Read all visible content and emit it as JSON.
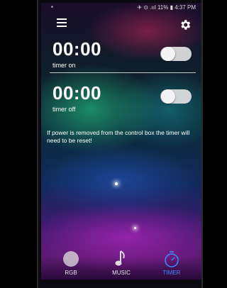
{
  "statusbar": {
    "right": "✈ ⊙ .ııl 11% ▮ 4:37 PM"
  },
  "timer_on": {
    "time": "00:00",
    "label": "timer on"
  },
  "timer_off": {
    "time": "00:00",
    "label": "timer off"
  },
  "notice": "If power is removed from the control box the timer will need to be reset!",
  "nav": {
    "rgb": "RGB",
    "music": "MUSIC",
    "timer": "TIMER"
  },
  "colors": {
    "active_tab": "#3a8cff",
    "text": "#ffffff"
  },
  "icons": [
    "menu-icon",
    "gear-icon",
    "toggle-switch",
    "music-note-icon",
    "timer-icon"
  ]
}
